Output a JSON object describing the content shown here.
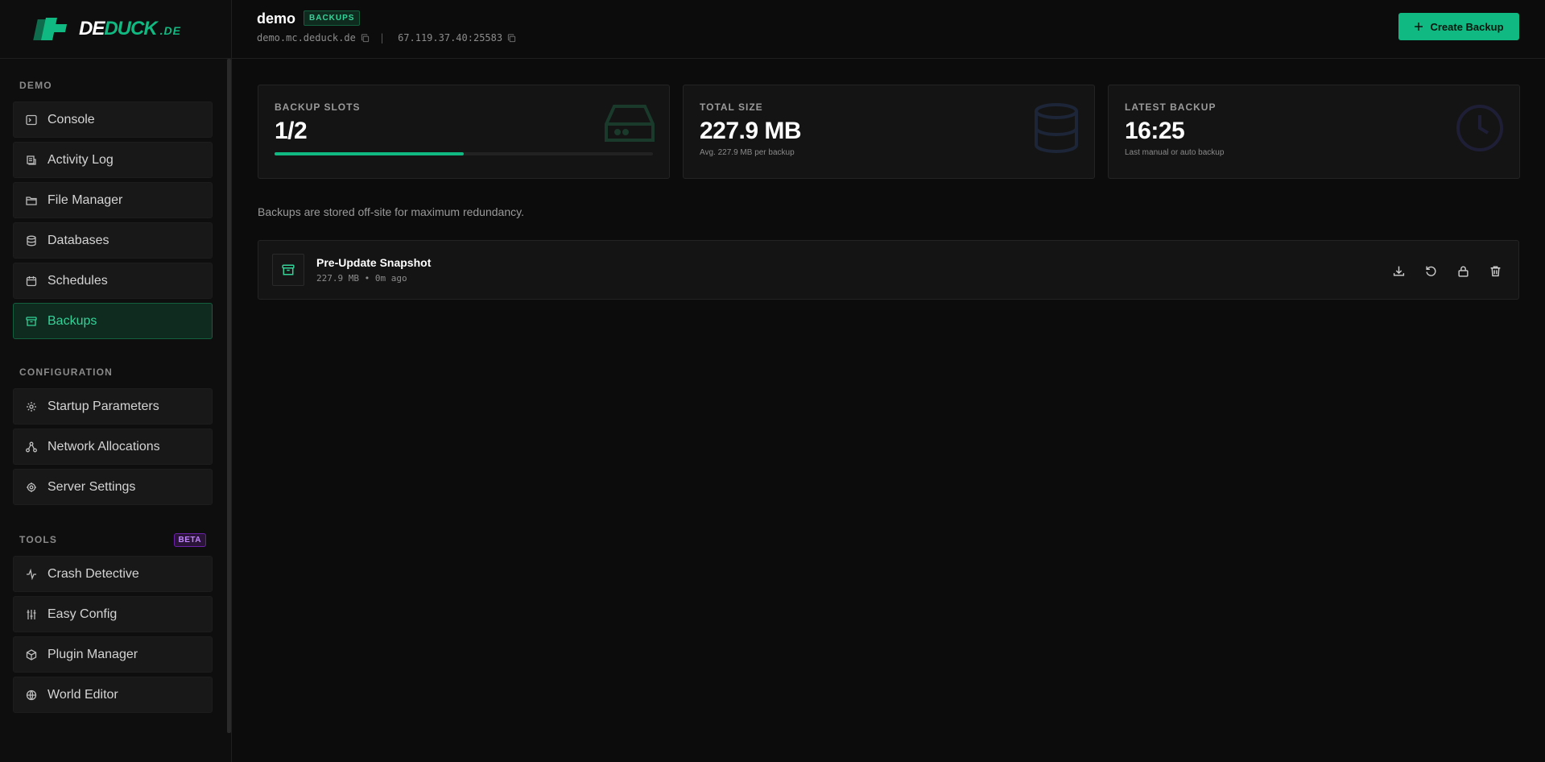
{
  "brand": {
    "prefix": "DE",
    "accent": "DUCK",
    "tld": ".DE"
  },
  "sidebar": {
    "sections": [
      {
        "label": "DEMO",
        "items": [
          {
            "label": "Console",
            "icon": "terminal-icon"
          },
          {
            "label": "Activity Log",
            "icon": "activity-log-icon"
          },
          {
            "label": "File Manager",
            "icon": "folder-icon"
          },
          {
            "label": "Databases",
            "icon": "database-icon"
          },
          {
            "label": "Schedules",
            "icon": "calendar-icon"
          },
          {
            "label": "Backups",
            "icon": "archive-icon",
            "active": true
          }
        ]
      },
      {
        "label": "CONFIGURATION",
        "items": [
          {
            "label": "Startup Parameters",
            "icon": "gear-icon"
          },
          {
            "label": "Network Allocations",
            "icon": "network-icon"
          },
          {
            "label": "Server Settings",
            "icon": "cog-icon"
          }
        ]
      },
      {
        "label": "TOOLS",
        "badge": "BETA",
        "items": [
          {
            "label": "Crash Detective",
            "icon": "pulse-icon"
          },
          {
            "label": "Easy Config",
            "icon": "sliders-icon"
          },
          {
            "label": "Plugin Manager",
            "icon": "package-icon"
          },
          {
            "label": "World Editor",
            "icon": "globe-icon"
          }
        ]
      }
    ]
  },
  "header": {
    "server_name": "demo",
    "page_badge": "BACKUPS",
    "domain": "demo.mc.deduck.de",
    "address": "67.119.37.40:25583",
    "separator": "|",
    "create_button": "Create Backup"
  },
  "stats": {
    "slots": {
      "label": "BACKUP SLOTS",
      "value": "1/2",
      "used": 1,
      "total": 2
    },
    "size": {
      "label": "TOTAL SIZE",
      "value": "227.9 MB",
      "sub": "Avg. 227.9 MB per backup"
    },
    "latest": {
      "label": "LATEST BACKUP",
      "value": "16:25",
      "sub": "Last manual or auto backup"
    }
  },
  "info_text": "Backups are stored off-site for maximum redundancy.",
  "backups": [
    {
      "name": "Pre-Update Snapshot",
      "meta": "227.9 MB • 0m ago"
    }
  ],
  "colors": {
    "accent": "#10b981",
    "beta": "#c084fc"
  }
}
